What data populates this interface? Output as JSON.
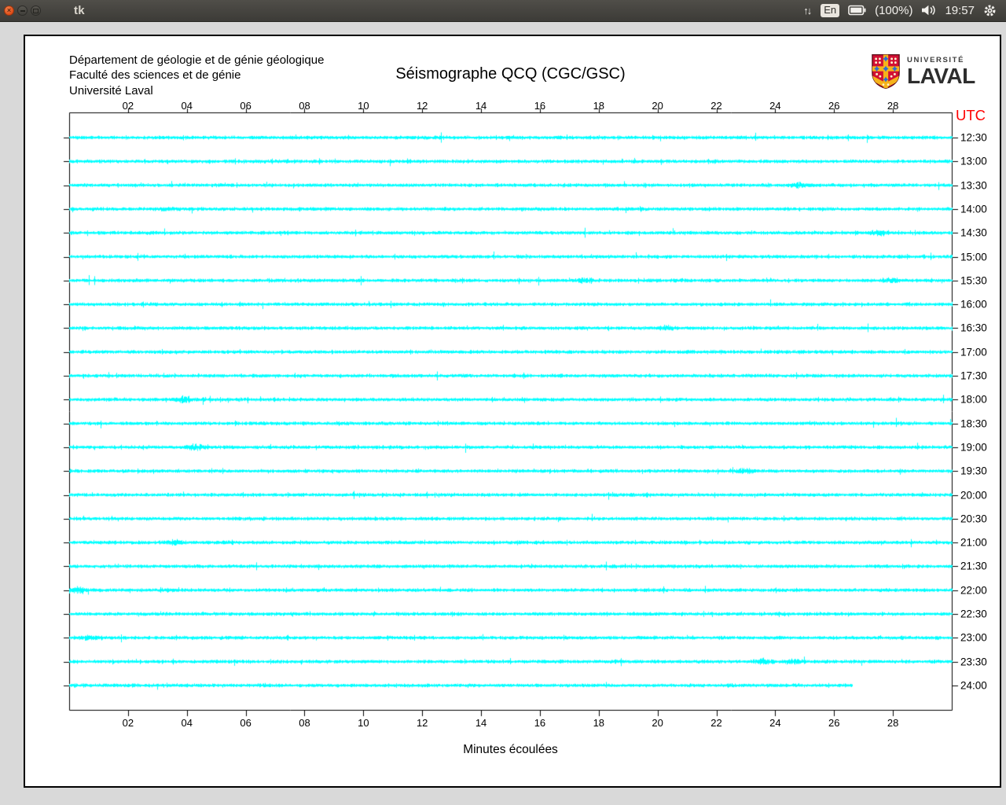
{
  "titlebar": {
    "title": "tk",
    "keyboard_layout": "En",
    "battery_percent": "(100%)",
    "clock": "19:57"
  },
  "window": {
    "header_lines": [
      "Département de géologie et de génie géologique",
      "Faculté des sciences et de génie",
      "Université Laval"
    ],
    "title": "Séismographe QCQ (CGC/GSC)",
    "logo": {
      "top": "UNIVERSITÉ",
      "bottom": "LAVAL"
    },
    "utc_label": "UTC",
    "xlabel": "Minutes écoulées"
  },
  "colors": {
    "trace": "#00ffff",
    "utc_label": "#ff0000",
    "axis": "#000000",
    "window_bg": "#ffffff",
    "desktop_bg": "#d9d9d9",
    "close_button": "#dd4814"
  },
  "chart_data": {
    "type": "line",
    "subtype": "seismogram-drum-record",
    "title": "Séismographe QCQ (CGC/GSC)",
    "station": "QCQ (CGC/GSC)",
    "xlabel": "Minutes écoulées",
    "ylabel_right": "UTC",
    "x_range_minutes": [
      0,
      30
    ],
    "x_tick_labels": [
      "02",
      "04",
      "06",
      "08",
      "10",
      "12",
      "14",
      "16",
      "18",
      "20",
      "22",
      "24",
      "26",
      "28"
    ],
    "x_tick_minutes": [
      2,
      4,
      6,
      8,
      10,
      12,
      14,
      16,
      18,
      20,
      22,
      24,
      26,
      28
    ],
    "grid": false,
    "trace_color": "#00ffff",
    "traces": [
      {
        "utc": "12:30",
        "seed": 101,
        "end_min": 30,
        "bursts": []
      },
      {
        "utc": "13:00",
        "seed": 102,
        "end_min": 30,
        "bursts": []
      },
      {
        "utc": "13:30",
        "seed": 103,
        "end_min": 30,
        "bursts": [
          [
            24.8,
            2.4
          ]
        ]
      },
      {
        "utc": "14:00",
        "seed": 104,
        "end_min": 30,
        "bursts": [
          [
            3.3,
            1.4
          ]
        ]
      },
      {
        "utc": "14:30",
        "seed": 105,
        "end_min": 30,
        "bursts": [
          [
            27.5,
            2.0
          ]
        ]
      },
      {
        "utc": "15:00",
        "seed": 106,
        "end_min": 30,
        "bursts": []
      },
      {
        "utc": "15:30",
        "seed": 107,
        "end_min": 30,
        "bursts": [
          [
            17.5,
            2.0
          ],
          [
            27.9,
            1.8
          ]
        ]
      },
      {
        "utc": "16:00",
        "seed": 108,
        "end_min": 30,
        "bursts": []
      },
      {
        "utc": "16:30",
        "seed": 109,
        "end_min": 30,
        "bursts": [
          [
            20.3,
            1.8
          ]
        ]
      },
      {
        "utc": "17:00",
        "seed": 110,
        "end_min": 30,
        "bursts": []
      },
      {
        "utc": "17:30",
        "seed": 111,
        "end_min": 30,
        "bursts": []
      },
      {
        "utc": "18:00",
        "seed": 112,
        "end_min": 30,
        "bursts": [
          [
            3.85,
            2.6
          ]
        ]
      },
      {
        "utc": "18:30",
        "seed": 113,
        "end_min": 30,
        "bursts": []
      },
      {
        "utc": "19:00",
        "seed": 114,
        "end_min": 30,
        "bursts": [
          [
            4.25,
            2.3
          ]
        ]
      },
      {
        "utc": "19:30",
        "seed": 115,
        "end_min": 30,
        "bursts": [
          [
            23.0,
            1.8
          ]
        ]
      },
      {
        "utc": "20:00",
        "seed": 116,
        "end_min": 30,
        "bursts": []
      },
      {
        "utc": "20:30",
        "seed": 117,
        "end_min": 30,
        "bursts": []
      },
      {
        "utc": "21:00",
        "seed": 118,
        "end_min": 30,
        "bursts": [
          [
            3.5,
            2.3
          ]
        ]
      },
      {
        "utc": "21:30",
        "seed": 119,
        "end_min": 30,
        "bursts": []
      },
      {
        "utc": "22:00",
        "seed": 120,
        "end_min": 30,
        "bursts": [
          [
            0.3,
            2.8
          ]
        ]
      },
      {
        "utc": "22:30",
        "seed": 121,
        "end_min": 30,
        "bursts": []
      },
      {
        "utc": "23:00",
        "seed": 122,
        "end_min": 30,
        "bursts": [
          [
            0.7,
            1.4
          ]
        ]
      },
      {
        "utc": "23:30",
        "seed": 123,
        "end_min": 30,
        "bursts": [
          [
            23.6,
            2.4
          ],
          [
            24.6,
            2.0
          ]
        ]
      },
      {
        "utc": "24:00",
        "seed": 124,
        "end_min": 26.6,
        "bursts": []
      }
    ]
  }
}
